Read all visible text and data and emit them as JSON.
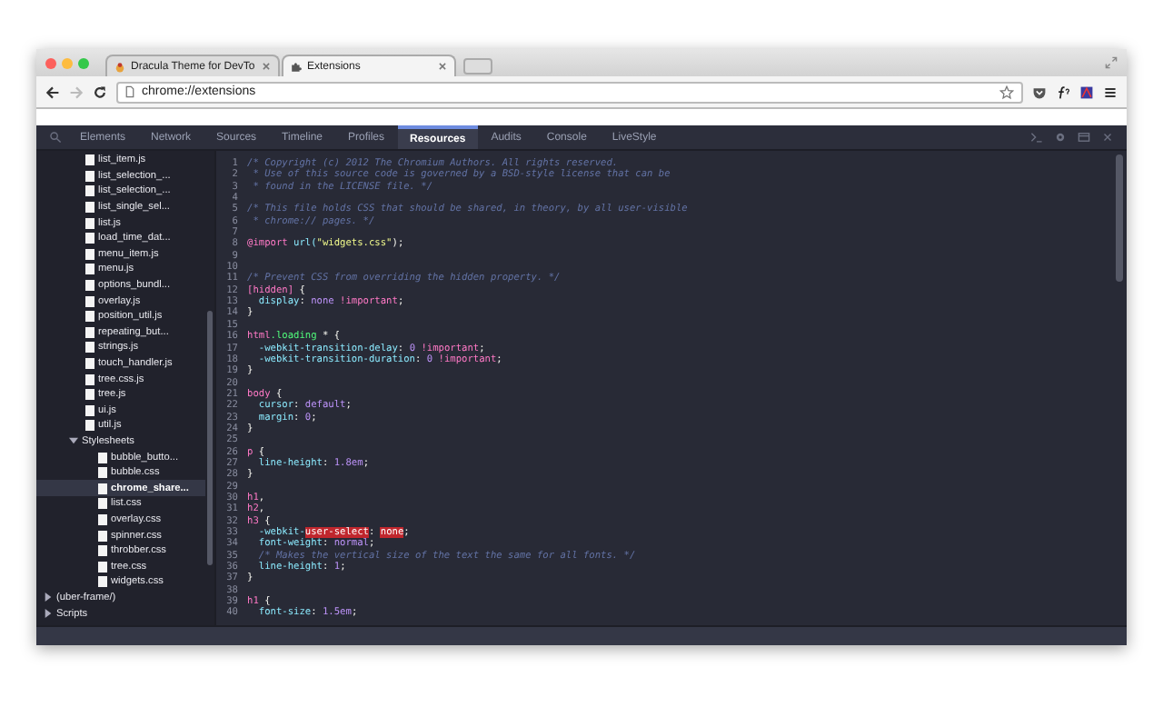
{
  "browser": {
    "tabs": [
      {
        "title": "Dracula Theme for DevTo",
        "selected": false
      },
      {
        "title": "Extensions",
        "selected": true
      }
    ],
    "address": "chrome://extensions",
    "forward_disabled": true
  },
  "devtools": {
    "tabs": [
      {
        "label": "Elements",
        "selected": false
      },
      {
        "label": "Network",
        "selected": false
      },
      {
        "label": "Sources",
        "selected": false
      },
      {
        "label": "Timeline",
        "selected": false
      },
      {
        "label": "Profiles",
        "selected": false
      },
      {
        "label": "Resources",
        "selected": true
      },
      {
        "label": "Audits",
        "selected": false
      },
      {
        "label": "Console",
        "selected": false
      },
      {
        "label": "LiveStyle",
        "selected": false
      }
    ],
    "sidebar": {
      "items": [
        {
          "children": [
            {
              "children": [
                {
                  "label": "list_item.js",
                  "selected": false
                },
                {
                  "label": "list_selection_...",
                  "selected": false
                },
                {
                  "label": "list_selection_...",
                  "selected": false
                },
                {
                  "label": "list_single_sel...",
                  "selected": false
                },
                {
                  "label": "list.js",
                  "selected": false
                },
                {
                  "label": "load_time_dat...",
                  "selected": false
                },
                {
                  "label": "menu_item.js",
                  "selected": false
                },
                {
                  "label": "menu.js",
                  "selected": false
                },
                {
                  "label": "options_bundl...",
                  "selected": false
                },
                {
                  "label": "overlay.js",
                  "selected": false
                },
                {
                  "label": "position_util.js",
                  "selected": false
                },
                {
                  "label": "repeating_but...",
                  "selected": false
                },
                {
                  "label": "strings.js",
                  "selected": false
                },
                {
                  "label": "touch_handler.js",
                  "selected": false
                },
                {
                  "label": "tree.css.js",
                  "selected": false
                },
                {
                  "label": "tree.js",
                  "selected": false
                },
                {
                  "label": "ui.js",
                  "selected": false
                },
                {
                  "label": "util.js",
                  "selected": false
                },
                {
                  "label": "Stylesheets",
                  "expanded": true,
                  "children": [
                    {
                      "label": "bubble_butto...",
                      "selected": false
                    },
                    {
                      "label": "bubble.css",
                      "selected": false
                    },
                    {
                      "label": "chrome_share...",
                      "selected": true
                    },
                    {
                      "label": "list.css",
                      "selected": false
                    },
                    {
                      "label": "overlay.css",
                      "selected": false
                    },
                    {
                      "label": "spinner.css",
                      "selected": false
                    },
                    {
                      "label": "throbber.css",
                      "selected": false
                    },
                    {
                      "label": "tree.css",
                      "selected": false
                    },
                    {
                      "label": "widgets.css",
                      "selected": false
                    }
                  ]
                }
              ]
            }
          ]
        },
        {
          "label": "(uber-frame/)",
          "expanded": false
        },
        {
          "label": "Scripts",
          "expanded": false
        }
      ]
    },
    "code": [
      {
        "number": "1",
        "tokens": [
          {
            "text": "/* Copyright (c) 2012 The Chromium Authors. All rights reserved.",
            "kind": "comment"
          }
        ]
      },
      {
        "number": "2",
        "tokens": [
          {
            "text": " * Use of this source code is governed by a BSD-style license that can be",
            "kind": "comment"
          }
        ]
      },
      {
        "number": "3",
        "tokens": [
          {
            "text": " * found in the LICENSE file. */",
            "kind": "comment"
          }
        ]
      },
      {
        "number": "4"
      },
      {
        "number": "5",
        "tokens": [
          {
            "text": "/* This file holds CSS that should be shared, in theory, by all user-visible",
            "kind": "comment"
          }
        ]
      },
      {
        "number": "6",
        "tokens": [
          {
            "text": " * chrome:// pages. */",
            "kind": "comment"
          }
        ]
      },
      {
        "number": "7"
      },
      {
        "number": "8",
        "tokens": [
          {
            "text": "@import",
            "kind": "keyword"
          },
          {
            "text": " url(",
            "kind": "function"
          },
          {
            "text": "\"widgets.css\"",
            "kind": "string"
          },
          {
            "text": ");",
            "kind": "plain"
          }
        ]
      },
      {
        "number": "9"
      },
      {
        "number": "10"
      },
      {
        "number": "11",
        "tokens": [
          {
            "text": "/* Prevent CSS from overriding the hidden property. */",
            "kind": "comment"
          }
        ]
      },
      {
        "number": "12",
        "tokens": [
          {
            "text": "[hidden]",
            "kind": "selector"
          },
          {
            "text": " {",
            "kind": "plain"
          }
        ]
      },
      {
        "number": "13",
        "tokens": [
          {
            "text": "  display",
            "kind": "property"
          },
          {
            "text": ": ",
            "kind": "plain"
          },
          {
            "text": "none",
            "kind": "value"
          },
          {
            "text": " !important",
            "kind": "important"
          },
          {
            "text": ";",
            "kind": "plain"
          }
        ]
      },
      {
        "number": "14",
        "tokens": [
          {
            "text": "}",
            "kind": "plain"
          }
        ]
      },
      {
        "number": "15"
      },
      {
        "number": "16",
        "tokens": [
          {
            "text": "html",
            "kind": "selector"
          },
          {
            "text": ".loading",
            "kind": "class"
          },
          {
            "text": " * {",
            "kind": "plain"
          }
        ]
      },
      {
        "number": "17",
        "tokens": [
          {
            "text": "  -webkit-transition-delay",
            "kind": "property"
          },
          {
            "text": ": ",
            "kind": "plain"
          },
          {
            "text": "0",
            "kind": "value"
          },
          {
            "text": " !important",
            "kind": "important"
          },
          {
            "text": ";",
            "kind": "plain"
          }
        ]
      },
      {
        "number": "18",
        "tokens": [
          {
            "text": "  -webkit-transition-duration",
            "kind": "property"
          },
          {
            "text": ": ",
            "kind": "plain"
          },
          {
            "text": "0",
            "kind": "value"
          },
          {
            "text": " !important",
            "kind": "important"
          },
          {
            "text": ";",
            "kind": "plain"
          }
        ]
      },
      {
        "number": "19",
        "tokens": [
          {
            "text": "}",
            "kind": "plain"
          }
        ]
      },
      {
        "number": "20"
      },
      {
        "number": "21",
        "tokens": [
          {
            "text": "body",
            "kind": "selector"
          },
          {
            "text": " {",
            "kind": "plain"
          }
        ]
      },
      {
        "number": "22",
        "tokens": [
          {
            "text": "  cursor",
            "kind": "property"
          },
          {
            "text": ": ",
            "kind": "plain"
          },
          {
            "text": "default",
            "kind": "value"
          },
          {
            "text": ";",
            "kind": "plain"
          }
        ]
      },
      {
        "number": "23",
        "tokens": [
          {
            "text": "  margin",
            "kind": "property"
          },
          {
            "text": ": ",
            "kind": "plain"
          },
          {
            "text": "0",
            "kind": "value"
          },
          {
            "text": ";",
            "kind": "plain"
          }
        ]
      },
      {
        "number": "24",
        "tokens": [
          {
            "text": "}",
            "kind": "plain"
          }
        ]
      },
      {
        "number": "25"
      },
      {
        "number": "26",
        "tokens": [
          {
            "text": "p",
            "kind": "selector"
          },
          {
            "text": " {",
            "kind": "plain"
          }
        ]
      },
      {
        "number": "27",
        "tokens": [
          {
            "text": "  line-height",
            "kind": "property"
          },
          {
            "text": ": ",
            "kind": "plain"
          },
          {
            "text": "1.8em",
            "kind": "value"
          },
          {
            "text": ";",
            "kind": "plain"
          }
        ]
      },
      {
        "number": "28",
        "tokens": [
          {
            "text": "}",
            "kind": "plain"
          }
        ]
      },
      {
        "number": "29"
      },
      {
        "number": "30",
        "tokens": [
          {
            "text": "h1",
            "kind": "selector"
          },
          {
            "text": ",",
            "kind": "plain"
          }
        ]
      },
      {
        "number": "31",
        "tokens": [
          {
            "text": "h2",
            "kind": "selector"
          },
          {
            "text": ",",
            "kind": "plain"
          }
        ]
      },
      {
        "number": "32",
        "tokens": [
          {
            "text": "h3",
            "kind": "selector"
          },
          {
            "text": " {",
            "kind": "plain"
          }
        ]
      },
      {
        "number": "33",
        "tokens": [
          {
            "text": "  -webkit-",
            "kind": "property"
          },
          {
            "text": "user-select",
            "kind": "error"
          },
          {
            "text": ": ",
            "kind": "plain"
          },
          {
            "text": "none",
            "kind": "error"
          },
          {
            "text": ";",
            "kind": "plain"
          }
        ]
      },
      {
        "number": "34",
        "tokens": [
          {
            "text": "  font-weight",
            "kind": "property"
          },
          {
            "text": ": ",
            "kind": "plain"
          },
          {
            "text": "normal",
            "kind": "value"
          },
          {
            "text": ";",
            "kind": "plain"
          }
        ]
      },
      {
        "number": "35",
        "tokens": [
          {
            "text": "  /* Makes the vertical size of the text the same for all fonts. */",
            "kind": "comment"
          }
        ]
      },
      {
        "number": "36",
        "tokens": [
          {
            "text": "  line-height",
            "kind": "property"
          },
          {
            "text": ": ",
            "kind": "plain"
          },
          {
            "text": "1",
            "kind": "value"
          },
          {
            "text": ";",
            "kind": "plain"
          }
        ]
      },
      {
        "number": "37",
        "tokens": [
          {
            "text": "}",
            "kind": "plain"
          }
        ]
      },
      {
        "number": "38"
      },
      {
        "number": "39",
        "tokens": [
          {
            "text": "h1",
            "kind": "selector"
          },
          {
            "text": " {",
            "kind": "plain"
          }
        ]
      },
      {
        "number": "40",
        "tokens": [
          {
            "text": "  font-size",
            "kind": "property"
          },
          {
            "text": ": ",
            "kind": "plain"
          },
          {
            "text": "1.5em",
            "kind": "value"
          },
          {
            "text": ";",
            "kind": "plain"
          }
        ]
      }
    ]
  }
}
